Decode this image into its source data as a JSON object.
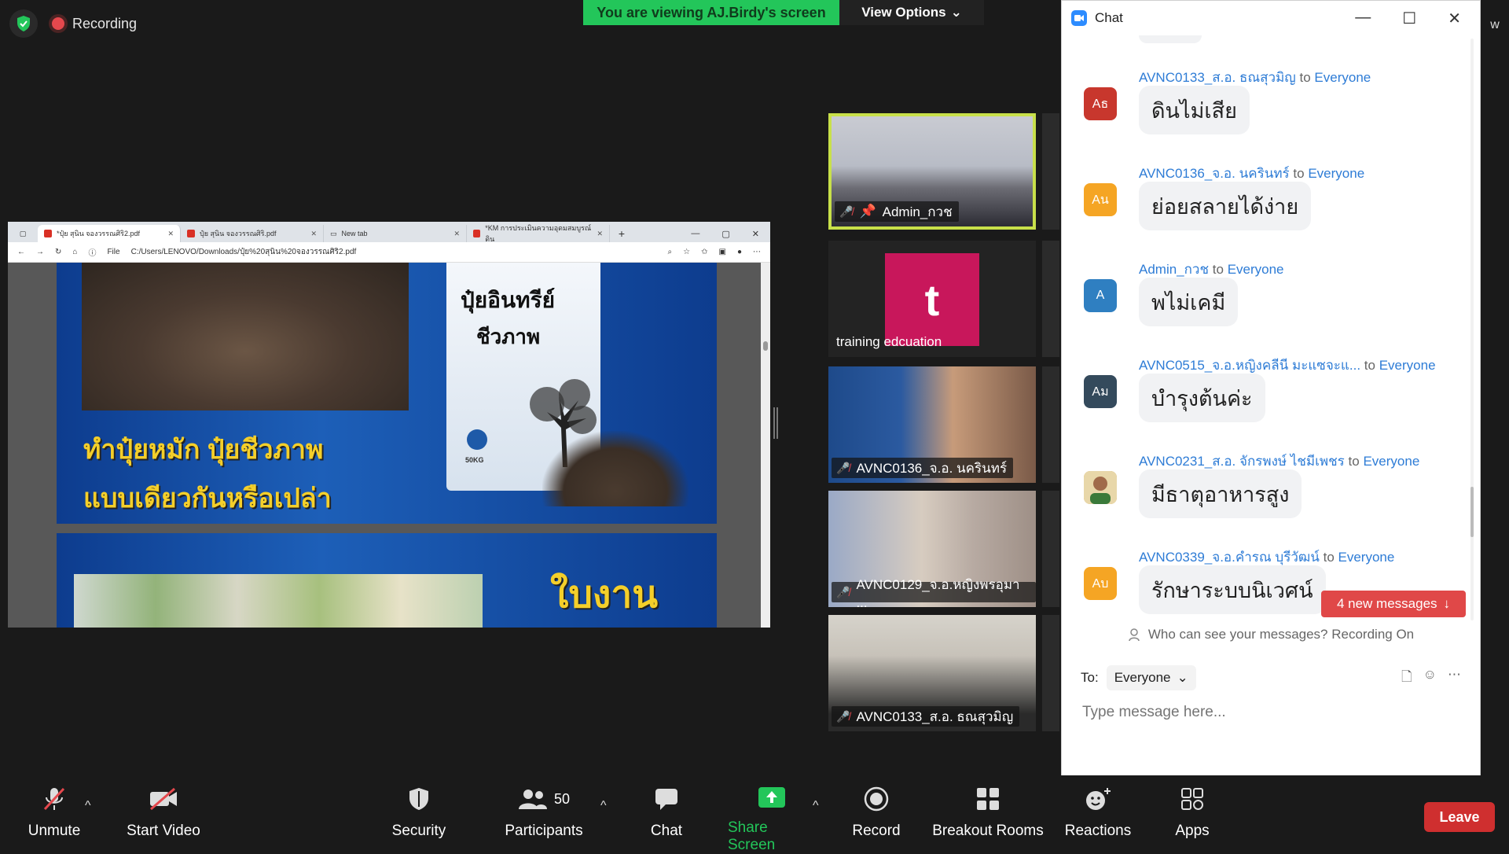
{
  "top": {
    "recording_label": "Recording",
    "viewing_banner": "You are viewing AJ.Birdy's screen",
    "view_options": "View Options"
  },
  "shared_screen": {
    "browser_tabs": [
      "*ปุ๋ย สุนิน จองวรรณศิริ2.pdf",
      "ปุ๋ย สุนิน จองวรรณศิริ.pdf",
      "New tab",
      "*KM การประเมินความอุดมสมบูรณ์ดิน"
    ],
    "file_label": "File",
    "url": "C:/Users/LENOVO/Downloads/ปุ๋ย%20สุนิน%20จองวรรณศิริ2.pdf",
    "slide1": {
      "bag_title_1": "ปุ๋ยอินทรีย์",
      "bag_title_2": "ชีวภาพ",
      "bag_weight": "50KG",
      "headline_1": "ทำปุ๋ยหมัก ปุ๋ยชีวภาพ",
      "headline_2": "แบบเดียวกันหรือเปล่า"
    },
    "slide2": {
      "title": "ใบงาน"
    }
  },
  "participants": [
    {
      "name": "Admin_กวช",
      "muted": true,
      "pinned": true,
      "active_speaker": true
    },
    {
      "name": "training edcuation",
      "avatar_letter": "t",
      "avatar_color": "#c8175b"
    },
    {
      "name": "AVNC0136_จ.อ. นครินทร์",
      "muted": true
    },
    {
      "name": "AVNC0129_จ.อ.หญิงพรอุมา ...",
      "muted": true
    },
    {
      "name": "AVNC0133_ส.อ. ธณสุวมิญ",
      "muted": true
    }
  ],
  "chat": {
    "title": "Chat",
    "messages": [
      {
        "sender": "AVNC0133_ส.อ. ธณสุวมิญ",
        "to_word": "to",
        "recipient": "Everyone",
        "avatar": "Aธ",
        "avatar_color": "#c8372d",
        "text": "ดินไม่เสีย"
      },
      {
        "sender": "AVNC0136_จ.อ. นครินทร์",
        "to_word": "to",
        "recipient": "Everyone",
        "avatar": "Aน",
        "avatar_color": "#f5a524",
        "text": "ย่อยสลายได้ง่าย"
      },
      {
        "sender": "Admin_กวช",
        "to_word": "to",
        "recipient": "Everyone",
        "avatar": "A",
        "avatar_color": "#2f7fc1",
        "text": "พไม่เคมี"
      },
      {
        "sender": "AVNC0515_จ.อ.หญิงคลีนี มะแซจะแ...",
        "to_word": "to",
        "recipient": "Everyone",
        "avatar": "Aม",
        "avatar_color": "#344a5c",
        "text": "บำรุงต้นค่ะ"
      },
      {
        "sender": "AVNC0231_ส.อ. จักรพงษ์ ไชมีเพชร",
        "to_word": "to",
        "recipient": "Everyone",
        "avatar": "photo",
        "avatar_color": "#d9a441",
        "text": "มีธาตุอาหารสูง"
      },
      {
        "sender": "AVNC0339_จ.อ.คำรณ บุรีวัฒน์",
        "to_word": "to",
        "recipient": "Everyone",
        "avatar": "Aบ",
        "avatar_color": "#f5a524",
        "text": "รักษาระบบนิเวศน์"
      }
    ],
    "new_messages_label": "4 new messages",
    "visibility_notice": "Who can see your messages? Recording On",
    "to_label": "To:",
    "to_value": "Everyone",
    "input_placeholder": "Type message here..."
  },
  "toolbar": {
    "unmute": "Unmute",
    "start_video": "Start Video",
    "security": "Security",
    "participants": "Participants",
    "participants_count": "50",
    "chat": "Chat",
    "share_screen": "Share Screen",
    "record": "Record",
    "breakout_rooms": "Breakout Rooms",
    "reactions": "Reactions",
    "apps": "Apps",
    "leave": "Leave"
  },
  "colors": {
    "accent_green": "#23c65a",
    "leave_red": "#cf2f2f",
    "link_blue": "#2e7cd6",
    "active_border": "#c8e04a"
  }
}
